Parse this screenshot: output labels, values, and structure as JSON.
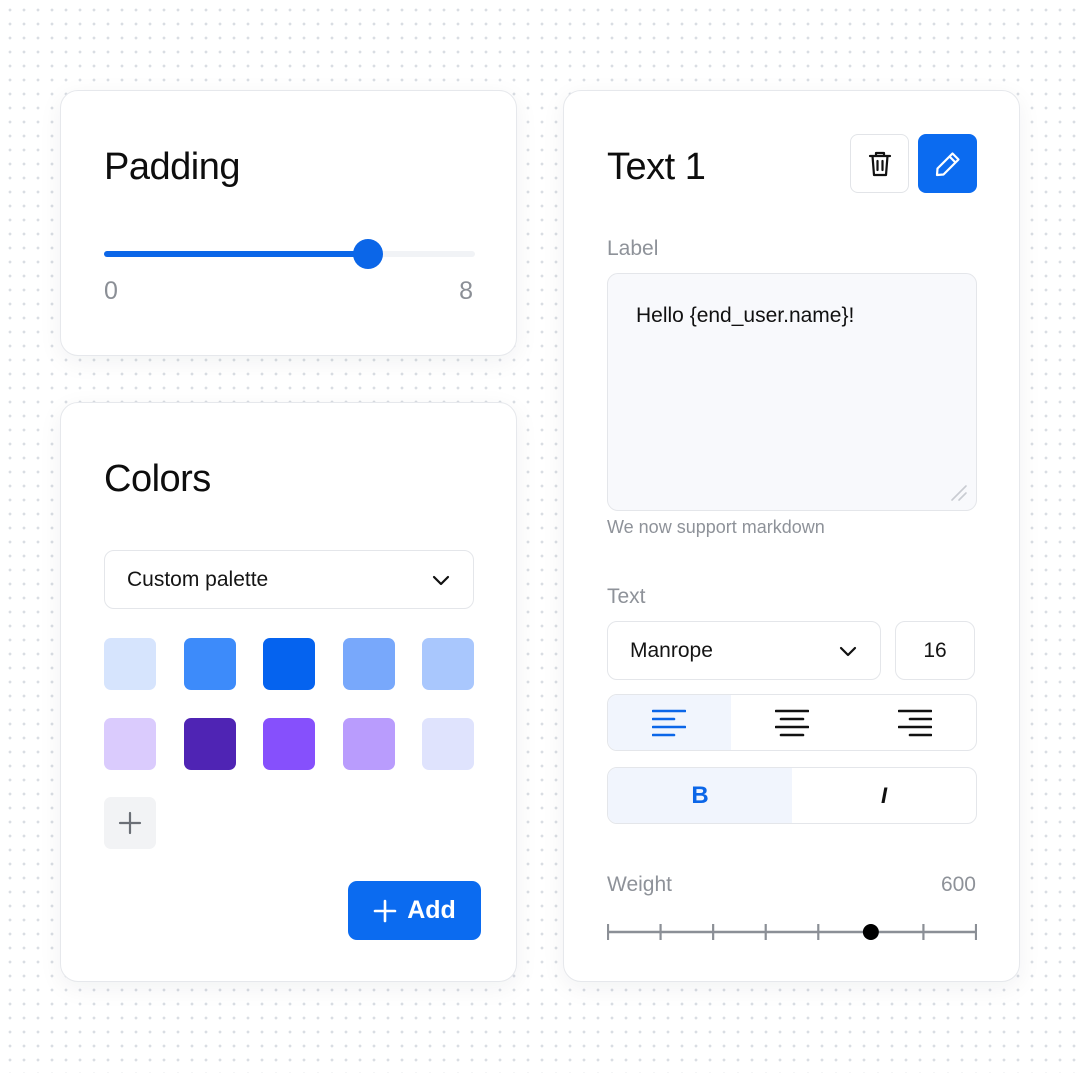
{
  "padding": {
    "title": "Padding",
    "min_label": "0",
    "max_label": "8",
    "min": 0,
    "max": 8,
    "value": 5.7
  },
  "colors": {
    "title": "Colors",
    "palette_select": "Custom palette",
    "swatches": [
      [
        "#d6e4fd",
        "#3d8bfa",
        "#0563ef",
        "#78a8fb",
        "#a9c7fd"
      ],
      [
        "#dacbfd",
        "#4f24b4",
        "#8650fc",
        "#b99cfd",
        "#dfe3fd"
      ]
    ],
    "add_label": "Add",
    "accent": "#0b6bf0"
  },
  "text_panel": {
    "title": "Text 1",
    "label_heading": "Label",
    "label_value": "Hello {end_user.name}!",
    "help_text": "We now support markdown",
    "text_heading": "Text",
    "font_family": "Manrope",
    "font_size": "16",
    "alignment_options": [
      "left",
      "center",
      "right"
    ],
    "alignment_selected": "left",
    "bold_label": "B",
    "italic_label": "I",
    "bold_active": true,
    "weight_heading": "Weight",
    "weight_value": "600",
    "weight_steps": [
      100,
      200,
      300,
      400,
      500,
      600,
      700,
      800
    ],
    "weight_current": 600
  },
  "icons": {
    "delete": "trash-icon",
    "edit": "pencil-icon",
    "dropdown": "chevron-down-icon",
    "add": "plus-icon"
  }
}
